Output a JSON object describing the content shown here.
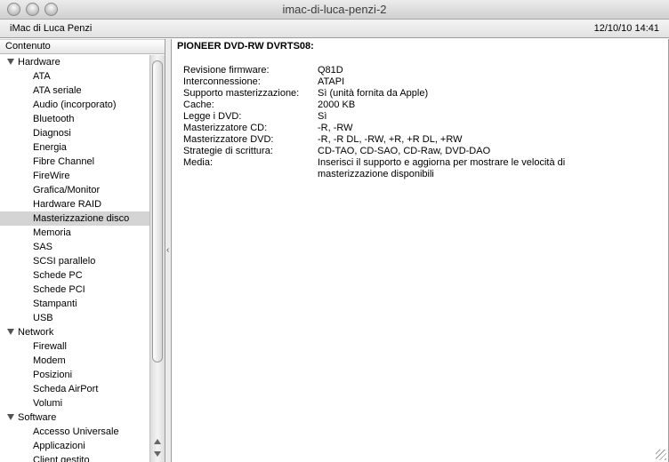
{
  "window": {
    "title": "imac-di-luca-penzi-2"
  },
  "infobar": {
    "computer_name": "iMac di Luca Penzi",
    "datetime": "12/10/10 14:41"
  },
  "sidebar": {
    "header": "Contenuto",
    "categories": [
      {
        "label": "Hardware",
        "items": [
          "ATA",
          "ATA seriale",
          "Audio (incorporato)",
          "Bluetooth",
          "Diagnosi",
          "Energia",
          "Fibre Channel",
          "FireWire",
          "Grafica/Monitor",
          "Hardware RAID",
          "Masterizzazione disco",
          "Memoria",
          "SAS",
          "SCSI parallelo",
          "Schede PC",
          "Schede PCI",
          "Stampanti",
          "USB"
        ]
      },
      {
        "label": "Network",
        "items": [
          "Firewall",
          "Modem",
          "Posizioni",
          "Scheda AirPort",
          "Volumi"
        ]
      },
      {
        "label": "Software",
        "items": [
          "Accesso Universale",
          "Applicazioni",
          "Client gestito"
        ]
      }
    ],
    "selected": "Masterizzazione disco"
  },
  "detail": {
    "device_title": "PIONEER DVD-RW  DVRTS08:",
    "properties": [
      {
        "key": "Revisione firmware:",
        "value": "Q81D"
      },
      {
        "key": "Interconnessione:",
        "value": "ATAPI"
      },
      {
        "key": "Supporto masterizzazione:",
        "value": "Sì (unità fornita da Apple)"
      },
      {
        "key": "Cache:",
        "value": "2000 KB"
      },
      {
        "key": "Legge i DVD:",
        "value": "Sì"
      },
      {
        "key": "Masterizzatore CD:",
        "value": "-R, -RW"
      },
      {
        "key": "Masterizzatore DVD:",
        "value": "-R, -R DL, -RW, +R, +R DL, +RW"
      },
      {
        "key": "Strategie di scrittura:",
        "value": "CD-TAO, CD-SAO, CD-Raw, DVD-DAO"
      },
      {
        "key": "Media:",
        "value": "Inserisci il supporto e aggiorna per mostrare le velocità di masterizzazione disponibili"
      }
    ]
  }
}
